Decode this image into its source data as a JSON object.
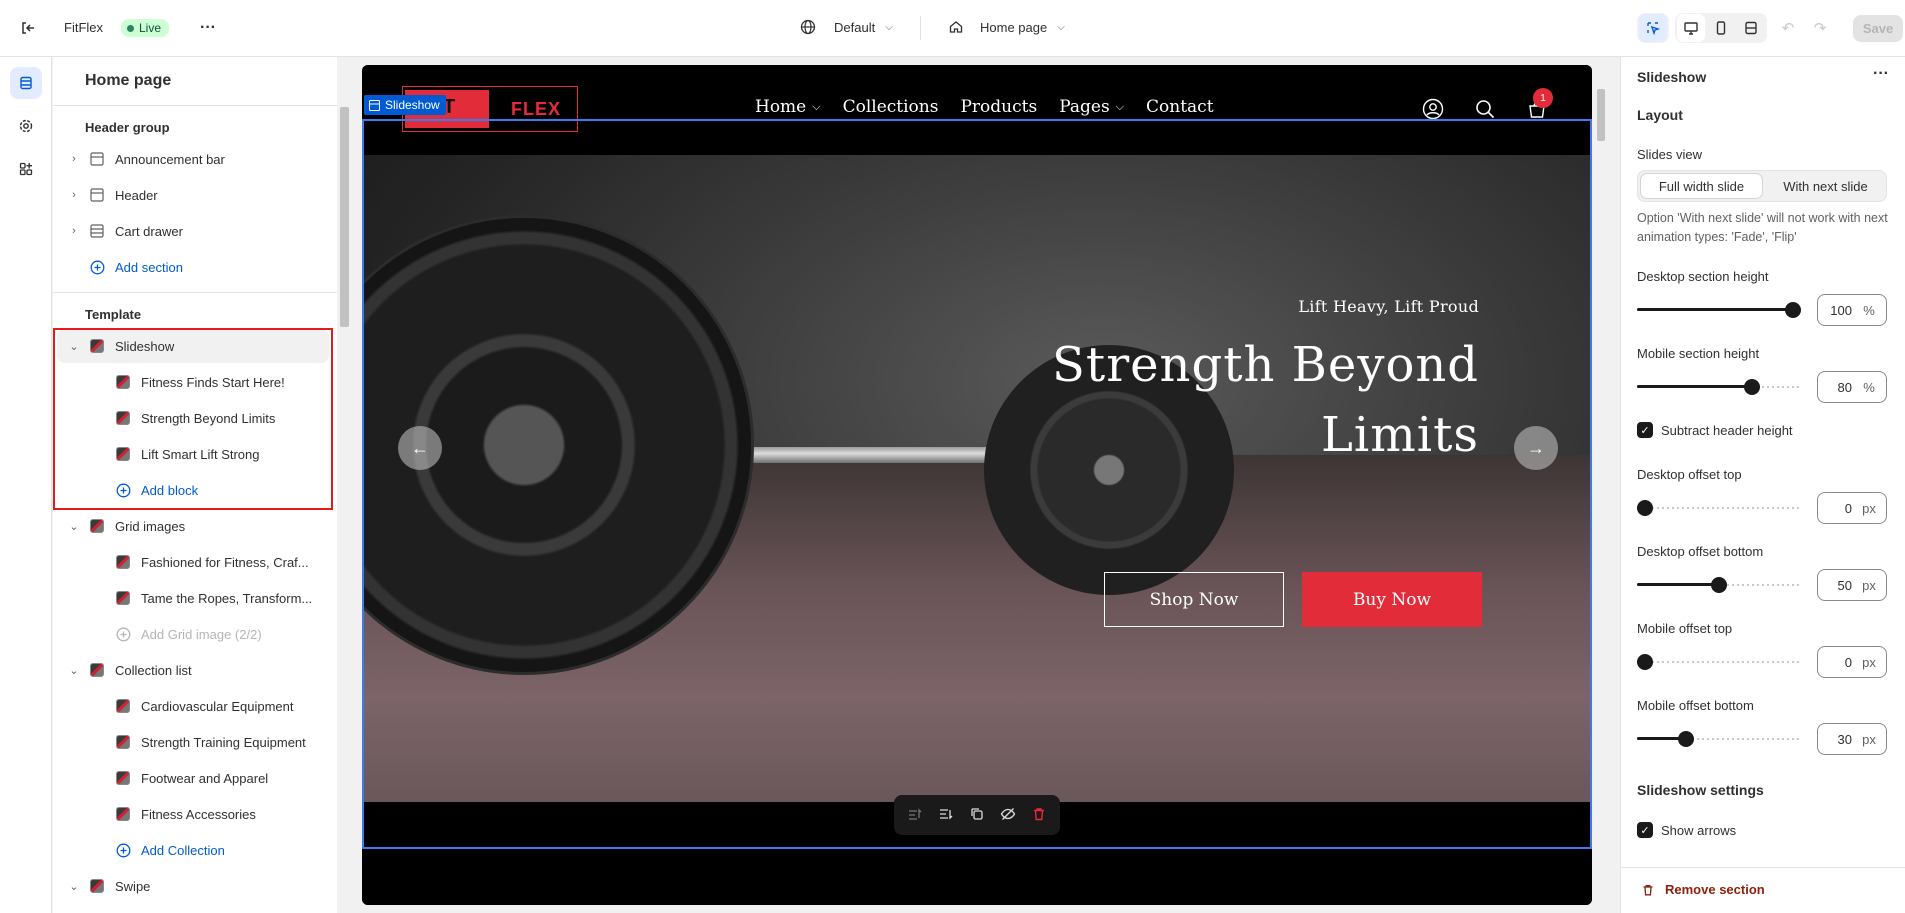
{
  "app": {
    "store_name": "FitFlex",
    "status": "Live",
    "theme_selector": "Default",
    "page_selector": "Home page",
    "save_label": "Save"
  },
  "sidebar": {
    "title": "Home page",
    "header_group_label": "Header group",
    "header_items": [
      "Announcement bar",
      "Header",
      "Cart drawer"
    ],
    "add_section": "Add section",
    "template_label": "Template",
    "slideshow": {
      "label": "Slideshow",
      "blocks": [
        "Fitness Finds Start Here!",
        "Strength Beyond Limits",
        "Lift Smart Lift Strong"
      ],
      "add_block": "Add block"
    },
    "grid_images": {
      "label": "Grid images",
      "blocks": [
        "Fashioned for Fitness, Craf...",
        "Tame the Ropes, Transform..."
      ],
      "add_block": "Add Grid image (2/2)"
    },
    "collection_list": {
      "label": "Collection list",
      "blocks": [
        "Cardiovascular Equipment",
        "Strength Training Equipment",
        "Footwear and Apparel",
        "Fitness Accessories"
      ],
      "add_block": "Add Collection"
    },
    "swipe_label": "Swipe"
  },
  "preview": {
    "section_tag": "Slideshow",
    "logo_text": "FLEX",
    "logo_prefix": "T",
    "nav": [
      "Home",
      "Collections",
      "Products",
      "Pages",
      "Contact"
    ],
    "cart_count": "1",
    "eyebrow": "Lift Heavy, Lift Proud",
    "headline_line1": "Strength Beyond",
    "headline_line2": "Limits",
    "btn_primary": "Shop Now",
    "btn_secondary": "Buy Now"
  },
  "settings": {
    "title": "Slideshow",
    "layout_heading": "Layout",
    "slides_view_label": "Slides view",
    "slides_view_options": [
      "Full width slide",
      "With next slide"
    ],
    "slides_view_selected": "Full width slide",
    "help_text": "Option 'With next slide' will not work with next animation types: 'Fade', 'Flip'",
    "desktop_height_label": "Desktop section height",
    "desktop_height_value": "100",
    "desktop_height_unit": "%",
    "mobile_height_label": "Mobile section height",
    "mobile_height_value": "80",
    "mobile_height_unit": "%",
    "subtract_header_label": "Subtract header height",
    "desktop_offset_top_label": "Desktop offset top",
    "desktop_offset_top_value": "0",
    "desktop_offset_bottom_label": "Desktop offset bottom",
    "desktop_offset_bottom_value": "50",
    "mobile_offset_top_label": "Mobile offset top",
    "mobile_offset_top_value": "0",
    "mobile_offset_bottom_label": "Mobile offset bottom",
    "mobile_offset_bottom_value": "30",
    "px_unit": "px",
    "slideshow_settings_heading": "Slideshow settings",
    "show_arrows_label": "Show arrows",
    "remove_section": "Remove section",
    "slider_levels": {
      "desktop_height": 1.0,
      "mobile_height": 0.7,
      "desktop_offset_top": 0.0,
      "desktop_offset_bottom": 0.5,
      "mobile_offset_top": 0.0,
      "mobile_offset_bottom": 0.3
    }
  },
  "colors": {
    "accent": "#e32c3a",
    "selection": "#005bd3",
    "live_badge_bg": "#cdfed4"
  }
}
